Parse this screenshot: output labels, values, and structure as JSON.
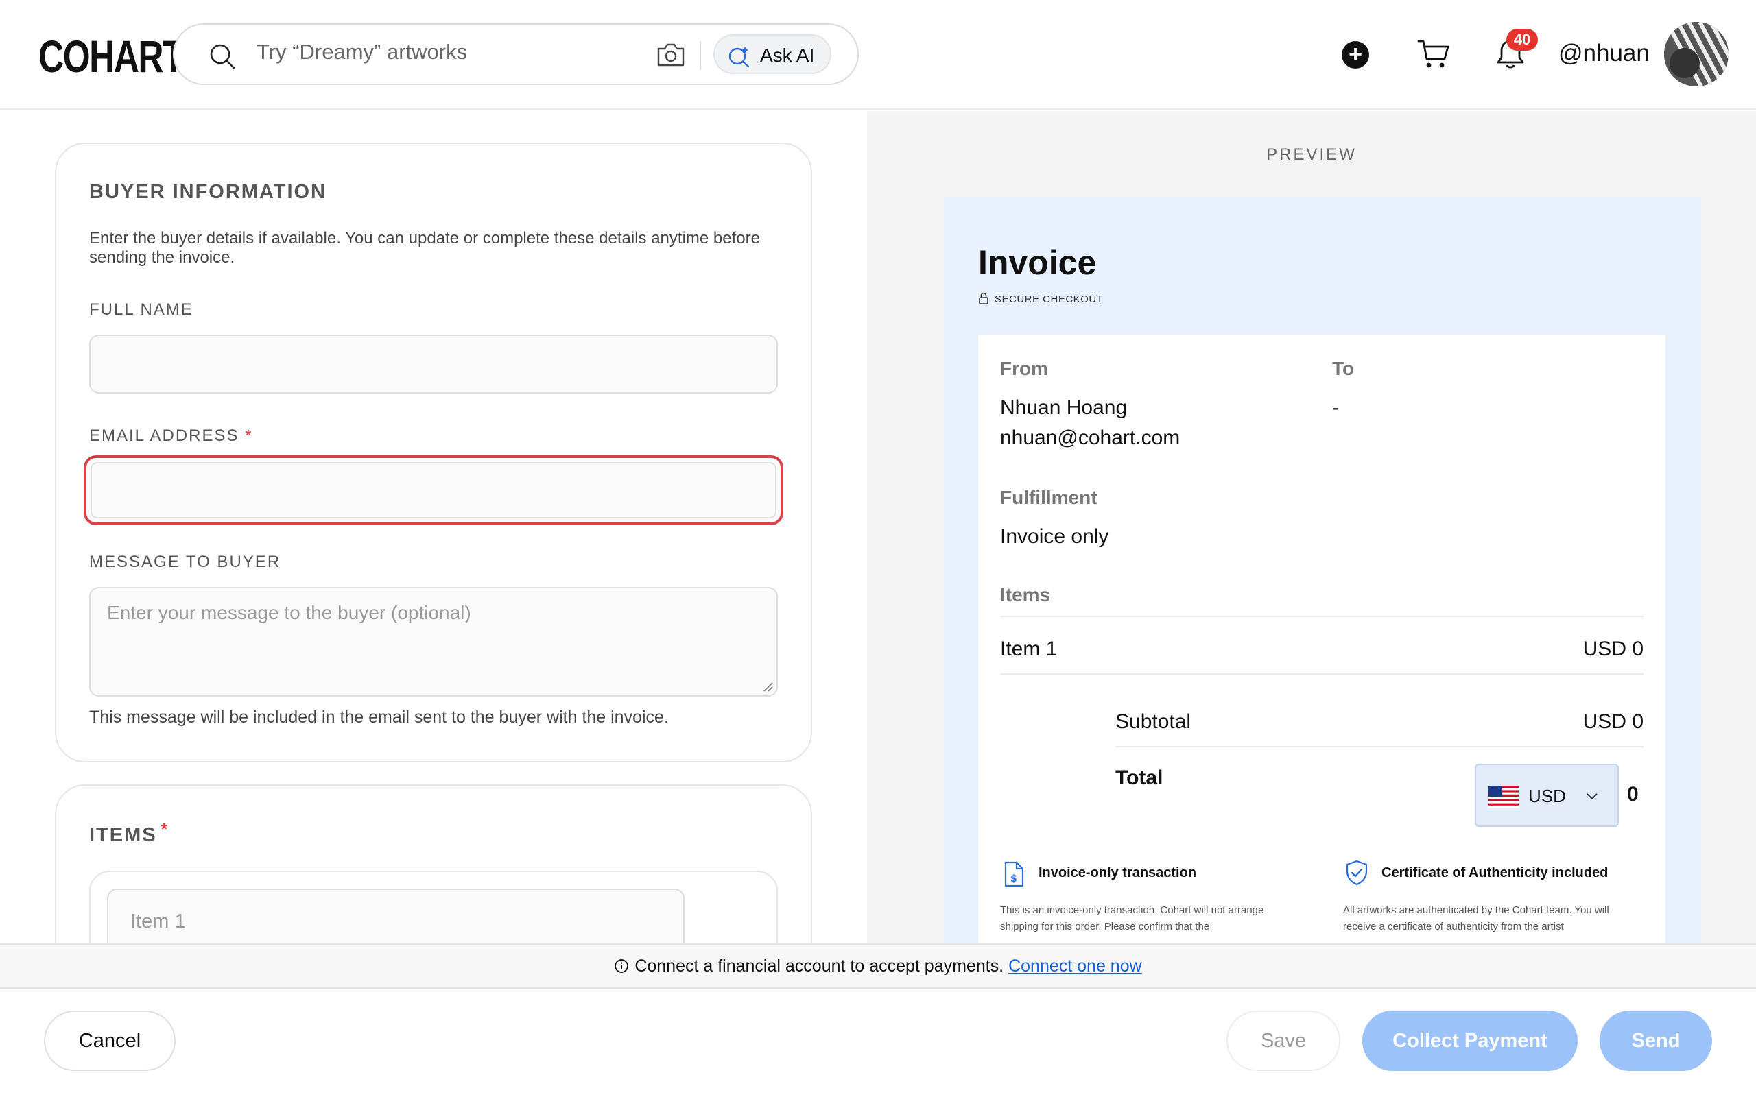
{
  "header": {
    "logo": "COHART",
    "search_placeholder": "Try “Dreamy” artworks",
    "ask_ai_label": "Ask AI",
    "notification_count": "40",
    "username": "@nhuan"
  },
  "buyer_section": {
    "title": "BUYER INFORMATION",
    "description": "Enter the buyer details if available. You can update or complete these details anytime before sending the invoice.",
    "full_name_label": "FULL NAME",
    "full_name_value": "",
    "email_label": "EMAIL ADDRESS",
    "email_value": "",
    "required_mark": "*",
    "message_label": "MESSAGE TO BUYER",
    "message_placeholder": "Enter your message to the buyer (optional)",
    "message_hint": "This message will be included in the email sent to the buyer with the invoice."
  },
  "items_section": {
    "title": "ITEMS",
    "required_mark": "*",
    "item_placeholder": "Item 1"
  },
  "preview": {
    "label": "PREVIEW",
    "invoice_title": "Invoice",
    "secure_label": "SECURE CHECKOUT",
    "from_label": "From",
    "from_name": "Nhuan Hoang",
    "from_email": "nhuan@cohart.com",
    "to_label": "To",
    "to_value": "-",
    "fulfillment_label": "Fulfillment",
    "fulfillment_value": "Invoice only",
    "items_label": "Items",
    "items": [
      {
        "name": "Item 1",
        "amount": "USD 0"
      }
    ],
    "subtotal_label": "Subtotal",
    "subtotal_value": "USD 0",
    "total_label": "Total",
    "currency": "USD",
    "total_value": "0",
    "features": [
      {
        "title": "Invoice-only transaction",
        "desc": "This is an invoice-only transaction. Cohart will not arrange shipping for this order. Please confirm that the"
      },
      {
        "title": "Certificate of Authenticity included",
        "desc": "All artworks are authenticated by the Cohart team. You will receive a certificate of authenticity from the artist"
      }
    ]
  },
  "notice": {
    "text": "Connect a financial account to accept payments.",
    "link": "Connect one now"
  },
  "footer": {
    "cancel": "Cancel",
    "save": "Save",
    "collect": "Collect Payment",
    "send": "Send"
  },
  "colors": {
    "error_border": "#d9444b",
    "primary_disabled": "#9cc3f9",
    "invoice_bg": "#e9f0fe",
    "link": "#1a5fd6",
    "badge": "#e5342d"
  }
}
